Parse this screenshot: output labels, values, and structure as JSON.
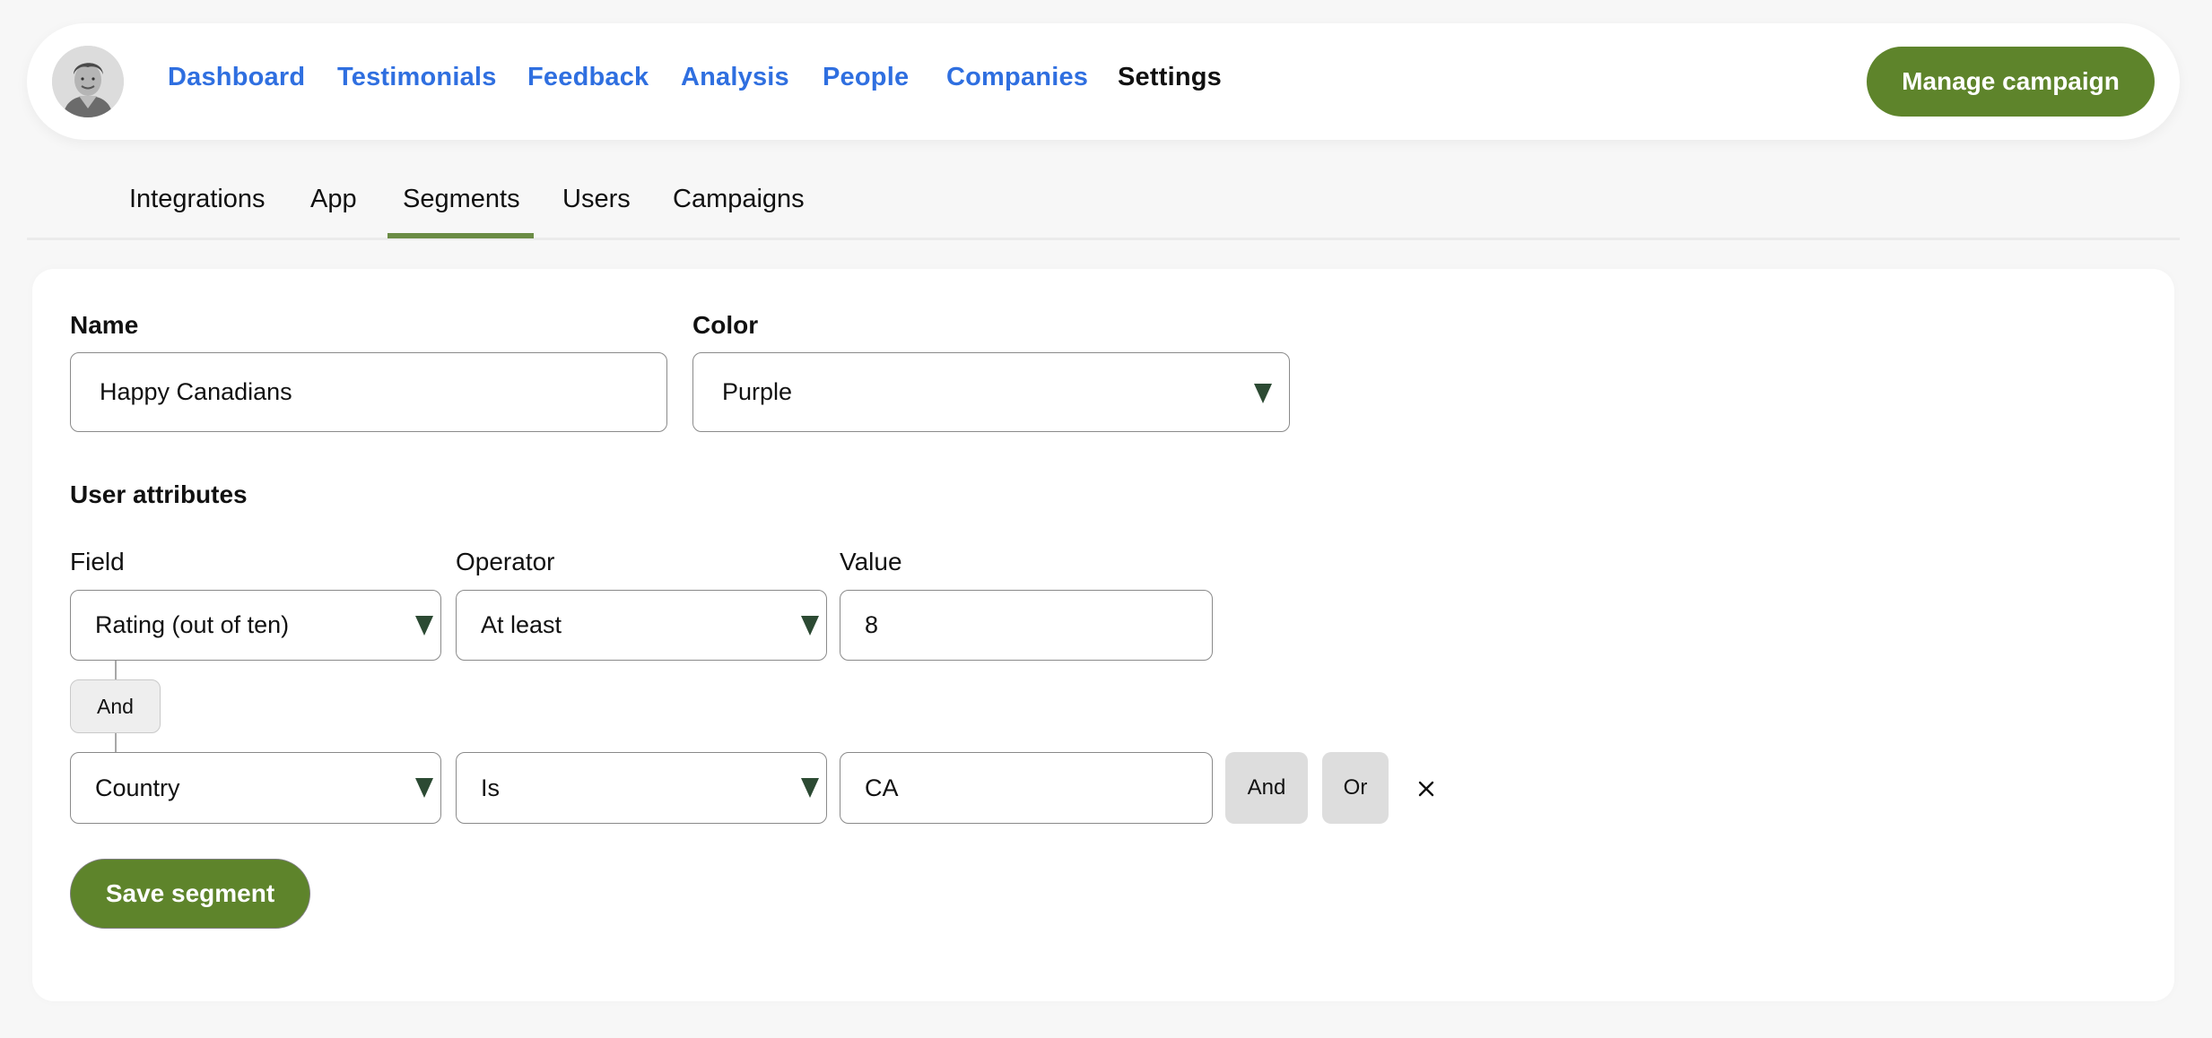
{
  "header": {
    "avatar_alt": "user-avatar",
    "nav": [
      {
        "label": "Dashboard",
        "active": false
      },
      {
        "label": "Testimonials",
        "active": false
      },
      {
        "label": "Feedback",
        "active": false
      },
      {
        "label": "Analysis",
        "active": false
      },
      {
        "label": "People",
        "active": false
      },
      {
        "label": "Companies",
        "active": false
      },
      {
        "label": "Settings",
        "active": true
      }
    ],
    "manage_campaign_label": "Manage campaign"
  },
  "subtabs": {
    "items": [
      {
        "label": "Integrations"
      },
      {
        "label": "App"
      },
      {
        "label": "Segments",
        "active": true
      },
      {
        "label": "Users"
      },
      {
        "label": "Campaigns"
      }
    ]
  },
  "segment_form": {
    "name_label": "Name",
    "name_value": "Happy Canadians",
    "color_label": "Color",
    "color_value": "Purple",
    "user_attributes_heading": "User attributes",
    "field_label": "Field",
    "operator_label": "Operator",
    "value_label": "Value",
    "conditions": [
      {
        "field": "Rating (out of ten)",
        "operator": "At least",
        "value": "8"
      },
      {
        "field": "Country",
        "operator": "Is",
        "value": "CA"
      }
    ],
    "joiner_label": "And",
    "add_and_label": "And",
    "add_or_label": "Or",
    "remove_icon": "close-icon",
    "save_label": "Save segment"
  },
  "colors": {
    "brand_green": "#5e842b",
    "link_blue": "#2f6fe0",
    "caret": "#2c4a33",
    "tab_underline": "#6b8c45"
  }
}
